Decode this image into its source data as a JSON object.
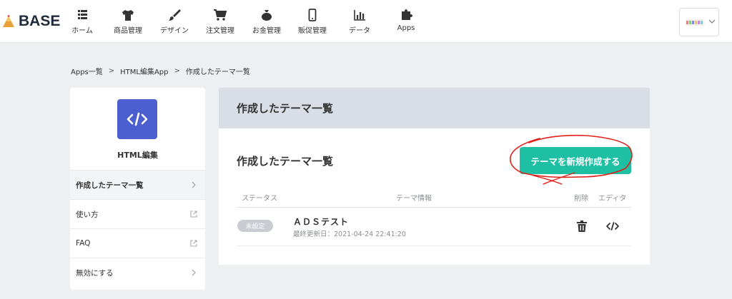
{
  "brand": {
    "name": "BASE"
  },
  "nav": {
    "items": [
      {
        "label": "ホーム",
        "icon": "list-icon"
      },
      {
        "label": "商品管理",
        "icon": "tshirt-icon"
      },
      {
        "label": "デザイン",
        "icon": "brush-icon"
      },
      {
        "label": "注文管理",
        "icon": "cart-icon"
      },
      {
        "label": "お金管理",
        "icon": "money-bag-icon"
      },
      {
        "label": "販促管理",
        "icon": "phone-icon"
      },
      {
        "label": "データ",
        "icon": "bar-chart-icon"
      },
      {
        "label": "Apps",
        "icon": "puzzle-icon"
      }
    ]
  },
  "breadcrumb": {
    "items": [
      "Apps一覧",
      "HTML編集App",
      "作成したテーマ一覧"
    ],
    "separator": ">"
  },
  "sidebar": {
    "app_name": "HTML編集",
    "app_icon": "code-icon",
    "items": [
      {
        "label": "作成したテーマ一覧",
        "trail": "chevron-right-icon",
        "active": true
      },
      {
        "label": "使い方",
        "trail": "external-link-icon"
      },
      {
        "label": "FAQ",
        "trail": "external-link-icon"
      },
      {
        "label": "無効にする",
        "trail": "chevron-right-icon"
      }
    ]
  },
  "main": {
    "header_title": "作成したテーマ一覧",
    "section_title": "作成したテーマ一覧",
    "create_button": "テーマを新規作成する",
    "columns": {
      "status": "ステータス",
      "info": "テーマ情報",
      "delete": "削除",
      "editor": "エディタ"
    },
    "themes": [
      {
        "status": "未設定",
        "name": "ＡＤＳテスト",
        "updated": "最終更新日：2021-04-24 22:41:20"
      }
    ]
  },
  "colors": {
    "accent": "#1fbfa3",
    "app_icon_bg": "#4b5fd0",
    "header_bg": "#d9dde5",
    "page_bg": "#eeeff1",
    "annotation": "#e0201b"
  }
}
